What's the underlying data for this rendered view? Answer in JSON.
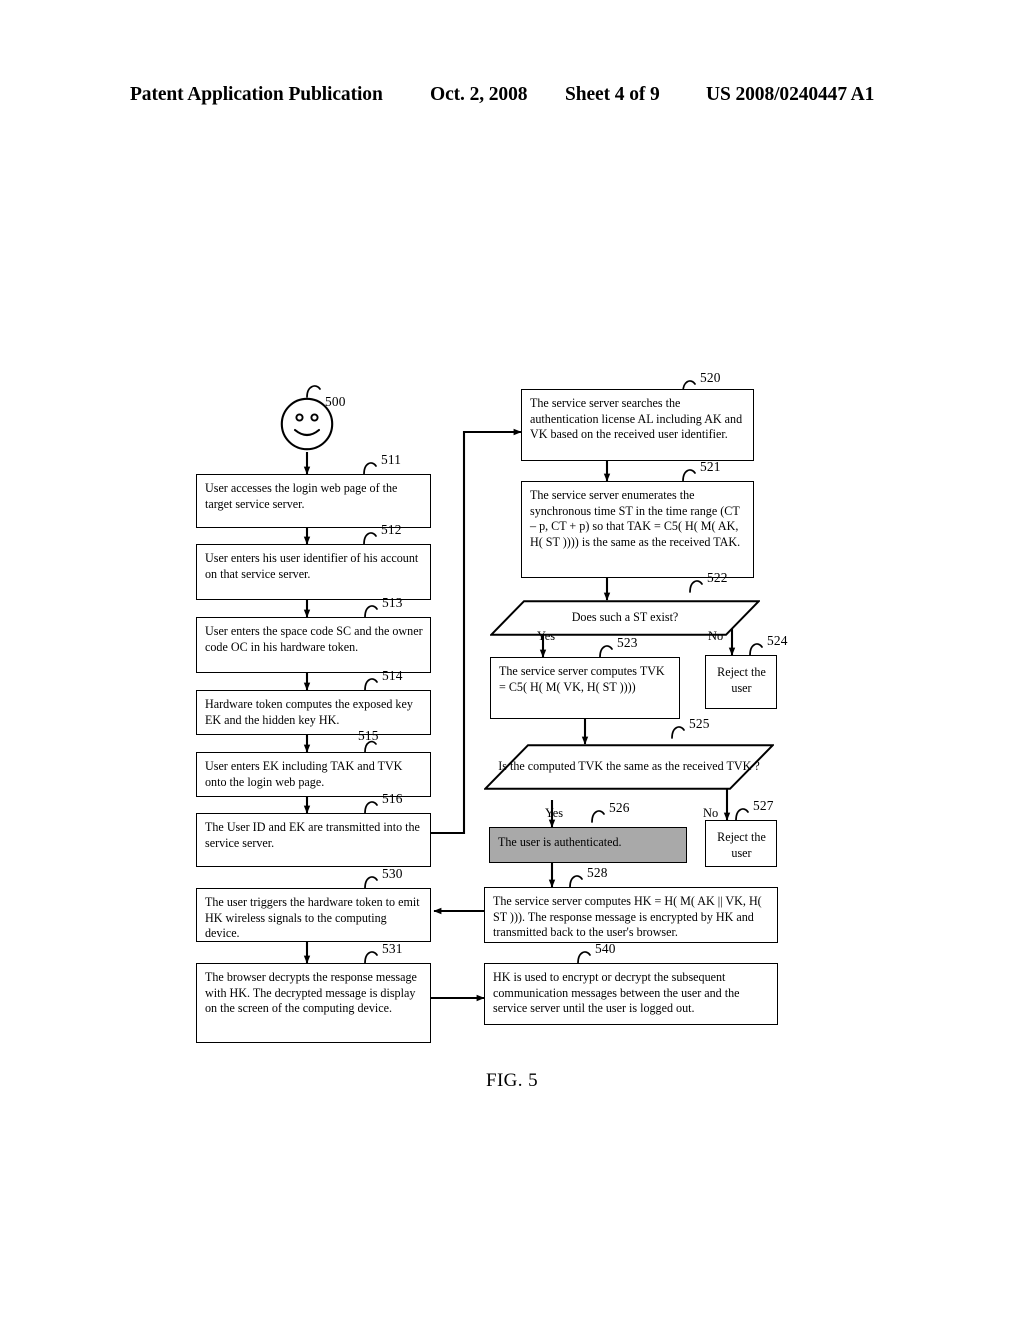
{
  "header": {
    "publication": "Patent Application Publication",
    "date": "Oct. 2, 2008",
    "sheet": "Sheet 4 of 9",
    "patent_number": "US 2008/0240447 A1"
  },
  "figure": {
    "caption": "FIG. 5",
    "actor": {
      "ref": "500",
      "icon": "smiley-face-icon"
    },
    "nodes": [
      {
        "ref": "511",
        "text": "User accesses the login web page of the target service server.",
        "shape": "process",
        "column": "left"
      },
      {
        "ref": "512",
        "text": "User enters his user identifier of his account on that service server.",
        "shape": "process",
        "column": "left"
      },
      {
        "ref": "513",
        "text": "User enters the space code SC and the owner code OC in his hardware token.",
        "shape": "process",
        "column": "left"
      },
      {
        "ref": "514",
        "text": "Hardware token computes the exposed key EK and the hidden key HK.",
        "shape": "process",
        "column": "left"
      },
      {
        "ref": "515",
        "text": "User enters EK including TAK and TVK onto the login web page.",
        "shape": "process",
        "column": "left"
      },
      {
        "ref": "516",
        "text": "The User ID and EK are transmitted into the service server.",
        "shape": "process",
        "column": "left"
      },
      {
        "ref": "530",
        "text": "The user triggers the hardware token to emit HK wireless signals to the computing device.",
        "shape": "process",
        "column": "left"
      },
      {
        "ref": "531",
        "text": "The browser decrypts the response message with HK. The decrypted message is display on the screen of the computing device.",
        "shape": "process",
        "column": "left"
      },
      {
        "ref": "520",
        "text": "The service server searches the authentication license AL including AK and VK  based on the received user identifier.",
        "shape": "process",
        "column": "right"
      },
      {
        "ref": "521",
        "text": "The service server enumerates the synchronous time ST in the time range (CT – p, CT + p) so that  TAK = C5( H( M( AK, H( ST )))) is the same as the received TAK.",
        "shape": "process",
        "column": "right"
      },
      {
        "ref": "522",
        "text": "Does such a ST exist?",
        "shape": "decision",
        "column": "right"
      },
      {
        "ref": "523",
        "text": "The service server computes TVK = C5( H( M( VK, H( ST ))))",
        "shape": "process",
        "column": "right"
      },
      {
        "ref": "524",
        "text": "Reject the user",
        "shape": "process",
        "column": "right"
      },
      {
        "ref": "525",
        "text": "Is the computed TVK the same as the received TVK ?",
        "shape": "decision",
        "column": "right"
      },
      {
        "ref": "526",
        "text": "The user is authenticated.",
        "shape": "process-shaded",
        "column": "right"
      },
      {
        "ref": "527",
        "text": "Reject the user",
        "shape": "process",
        "column": "right"
      },
      {
        "ref": "528",
        "text": "The service server computes HK = H( M( AK || VK, H( ST ))). The response message is encrypted by HK and transmitted back to the user's browser.",
        "shape": "process",
        "column": "right"
      },
      {
        "ref": "540",
        "text": "HK is used to encrypt or decrypt the subsequent communication messages between the user and the service server until the user is logged out.",
        "shape": "process",
        "column": "right"
      }
    ],
    "branch_labels": {
      "d522_yes": "Yes",
      "d522_no": "No",
      "d525_yes": "Yes",
      "d525_no": "No"
    },
    "colors": {
      "line": "#000000",
      "page": "#ffffff",
      "shaded_fill": "#a9a9a9"
    }
  }
}
